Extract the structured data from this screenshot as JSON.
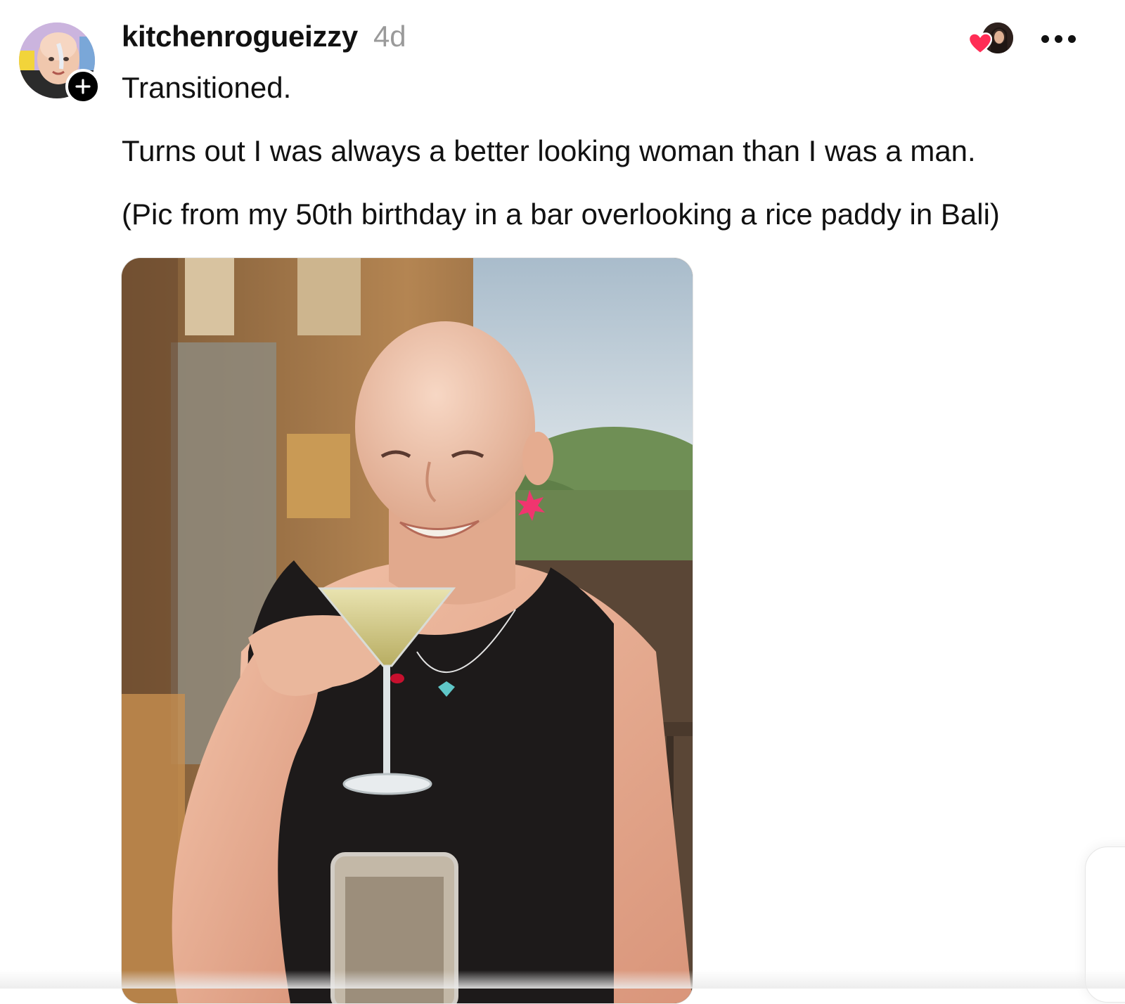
{
  "post": {
    "username": "kitchenrogueizzy",
    "timestamp": "4d",
    "paragraphs": [
      "Transitioned.",
      "Turns out I was always a better looking woman than I was a man.",
      "(Pic from my 50th birthday in a bar overlooking a rice paddy in Bali)"
    ],
    "photo_alt": "Pic from my 50th birthday in a bar overlooking a rice paddy in Bali"
  },
  "icons": {
    "follow": "plus-icon",
    "like": "heart-icon",
    "more": "more-horizontal-icon"
  },
  "colors": {
    "heart": "#ff2d55",
    "timestamp": "#9a9a9a",
    "text": "#111111"
  }
}
